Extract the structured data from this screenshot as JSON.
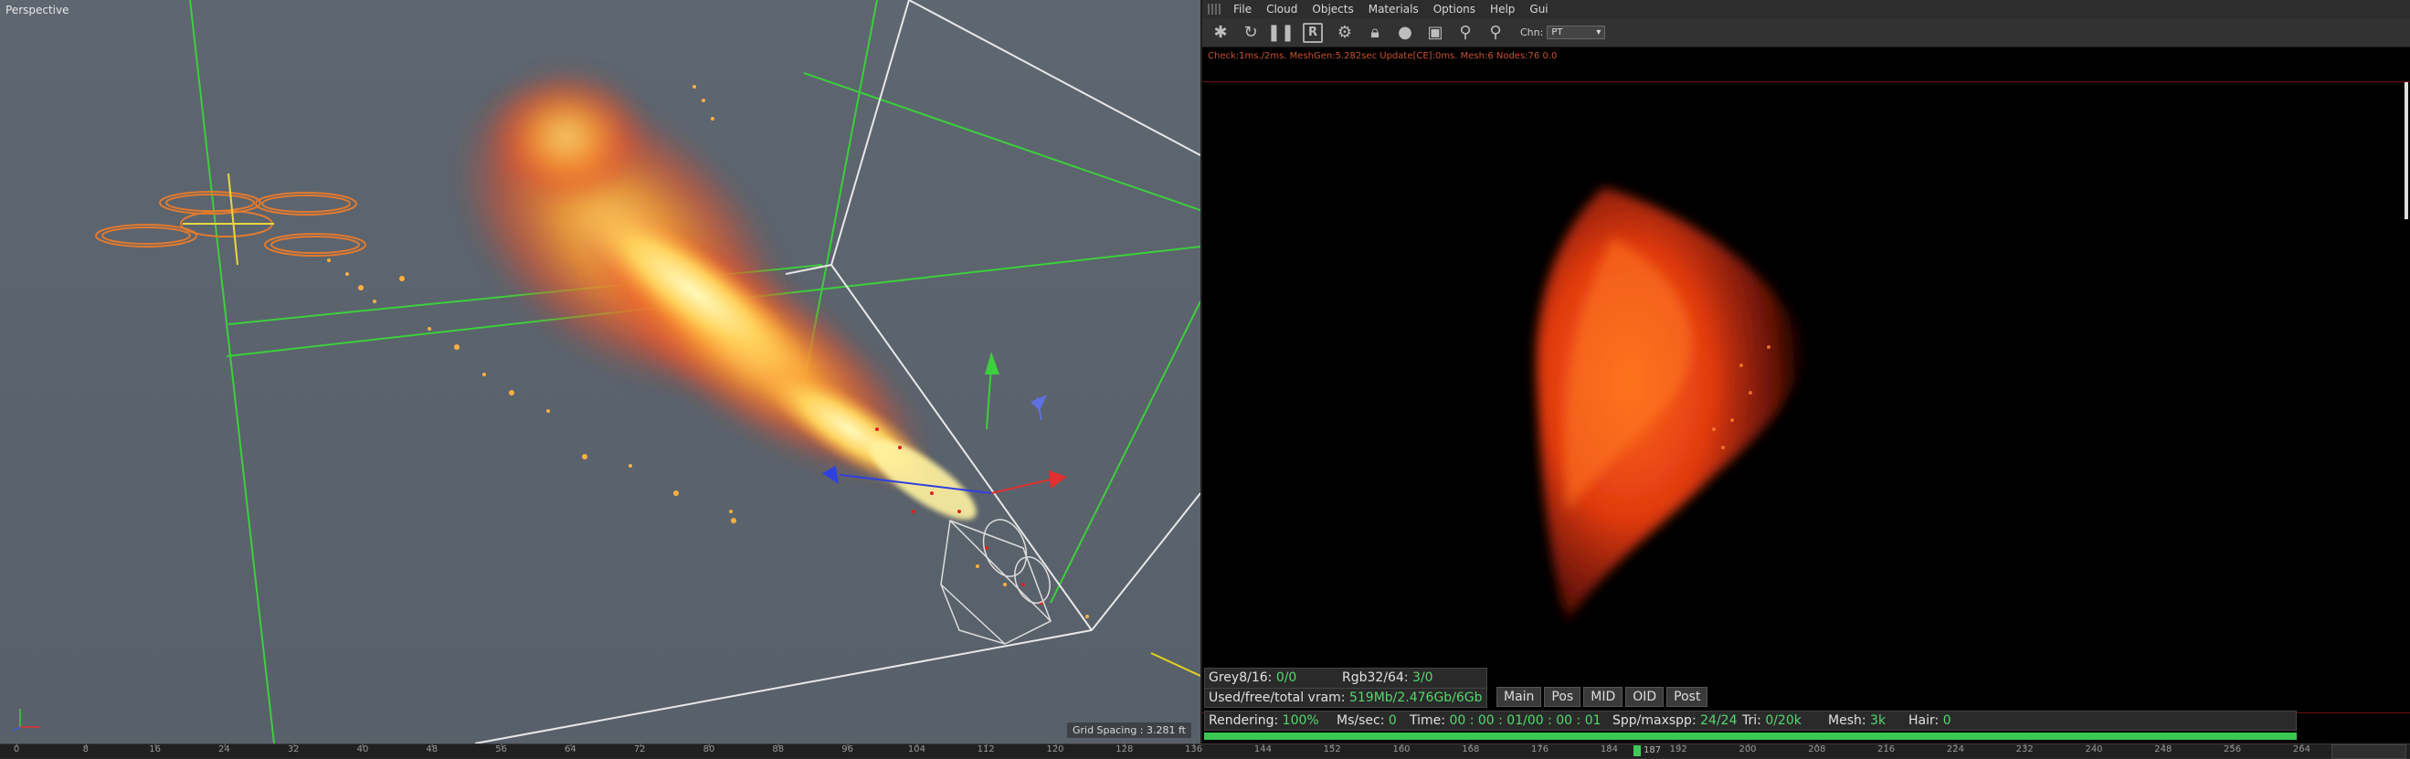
{
  "viewport": {
    "label": "Perspective",
    "grid_spacing": "Grid Spacing : 3.281 ft"
  },
  "menu": [
    "File",
    "Cloud",
    "Objects",
    "Materials",
    "Options",
    "Help",
    "Gui"
  ],
  "toolbar": {
    "icons": [
      "gear-icon",
      "refresh-icon",
      "pause-icon",
      "r-icon",
      "settings-icon",
      "lock-icon",
      "sphere-icon",
      "region-icon",
      "pin-icon",
      "pin2-icon"
    ],
    "chn_label": "Chn:",
    "chn_value": "PT"
  },
  "status_line": "Check:1ms./2ms. MeshGen:5.282sec Update[CE]:0ms. Mesh:6 Nodes:76  0.0",
  "memory": {
    "grey_label": "Grey8/16:",
    "grey_value": "0/0",
    "rgb_label": "Rgb32/64:",
    "rgb_value": "3/0",
    "vram_label": "Used/free/total vram:",
    "vram_value": "519Mb/2.476Gb/6Gb"
  },
  "passes": [
    "Main",
    "Pos",
    "MID",
    "OID",
    "Post"
  ],
  "render": {
    "rendering_label": "Rendering:",
    "rendering_value": "100%",
    "ms_label": "Ms/sec:",
    "ms_value": "0",
    "time_label": "Time:",
    "time_value": "00 : 00 : 01/00 : 00 : 01",
    "spp_label": "Spp/maxspp:",
    "spp_value": "24/24",
    "tri_label": "Tri:",
    "tri_value": "0/20k",
    "mesh_label": "Mesh:",
    "mesh_value": "3k",
    "hair_label": "Hair:",
    "hair_value": "0",
    "progress": 1.0
  },
  "timeline": {
    "ticks": [
      "0",
      "8",
      "16",
      "24",
      "32",
      "40",
      "48",
      "56",
      "64",
      "72",
      "80",
      "88",
      "96",
      "104",
      "112",
      "120",
      "128",
      "136",
      "144",
      "152",
      "160",
      "168",
      "176",
      "184",
      "192",
      "200",
      "208",
      "216",
      "224",
      "232",
      "240",
      "248",
      "256",
      "264"
    ],
    "current_frame": "187"
  }
}
